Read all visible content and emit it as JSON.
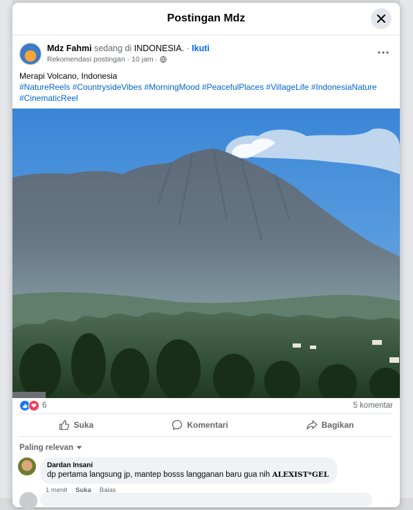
{
  "modal": {
    "title": "Postingan Mdz",
    "close_icon": "close-icon"
  },
  "post": {
    "author": "Mdz Fahmi",
    "location_prefix": "sedang di",
    "location": "INDONESIA.",
    "separator": "·",
    "follow_label": "Ikuti",
    "meta_label": "Rekomendasi postingan",
    "time": "10 jam",
    "privacy_icon": "globe-icon",
    "caption": "Merapi Volcano, Indonesia",
    "hashtags": "#NatureReels #CountrysideVibes #MorningMood #PeacefulPlaces #VillageLife #IndonesiaNature #CinematicReel"
  },
  "stats": {
    "reaction_count": "6",
    "comment_count": "5 komentar"
  },
  "actions": {
    "like": "Suka",
    "comment": "Komentari",
    "share": "Bagikan"
  },
  "comments_section": {
    "sort_label": "Paling relevan"
  },
  "comments": [
    {
      "author": "Dardan Insani",
      "text": "dp pertama langsung jp, mantep bosss langganan baru gua nih",
      "signature": "ALEXIST*GEL",
      "time": "1 menit",
      "like": "Suka",
      "reply": "Balas"
    }
  ],
  "colors": {
    "accent": "#0866ff",
    "hashtag": "#0064d1",
    "muted": "#65676b",
    "like_icon": "#1877f2",
    "love_icon": "#f33e58"
  }
}
